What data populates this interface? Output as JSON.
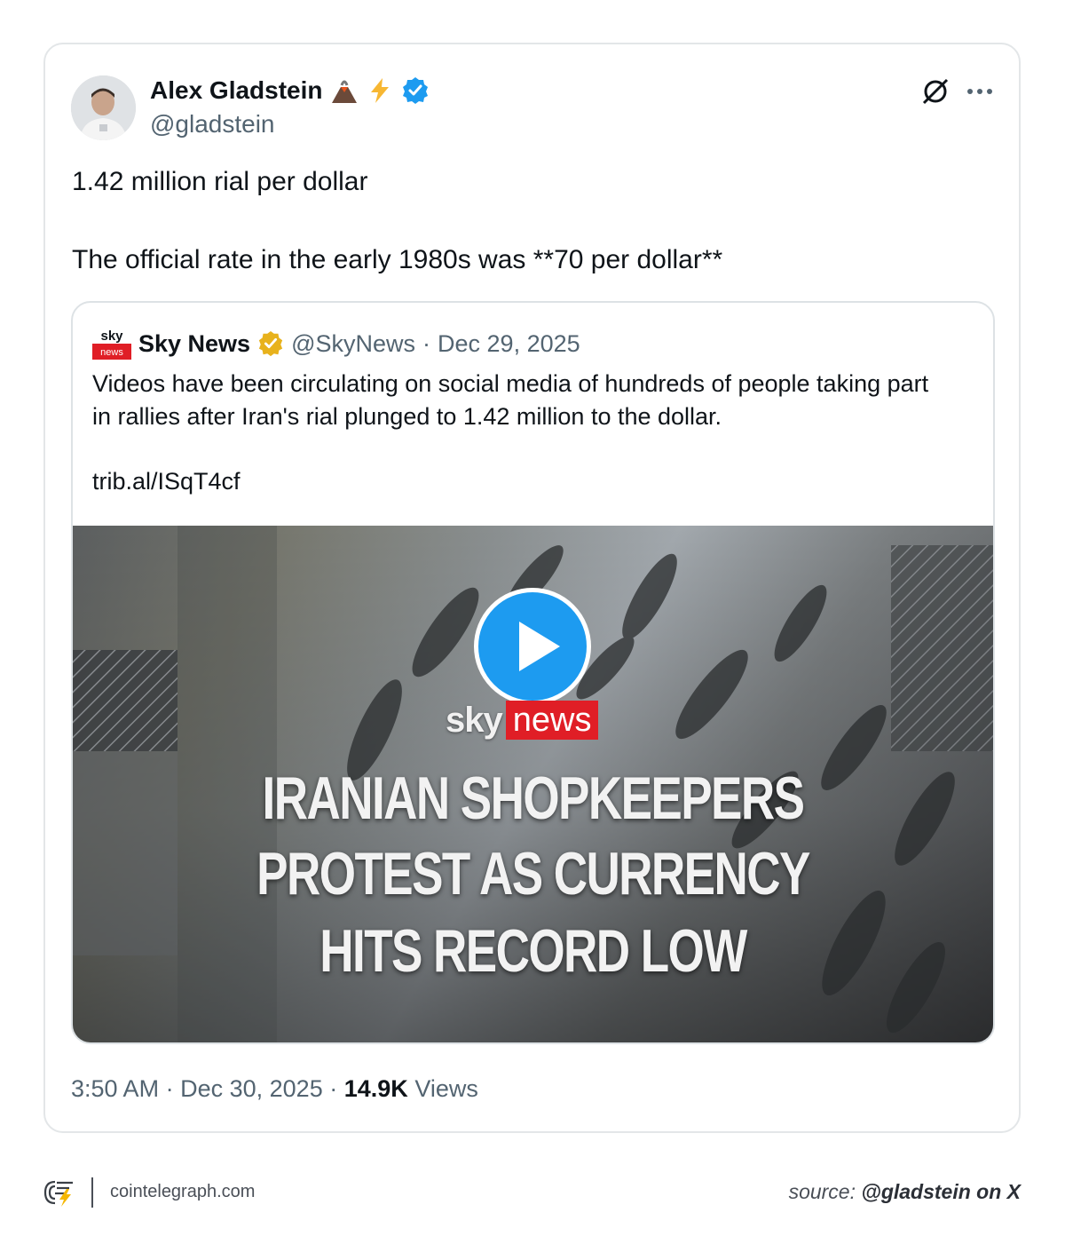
{
  "author": {
    "name": "Alex Gladstein",
    "handle": "@gladstein",
    "emoji": [
      "volcano-icon",
      "lightning-icon",
      "verified-badge-icon"
    ]
  },
  "tweet": {
    "line1": "1.42 million rial per dollar",
    "line2": "The official rate in the early 1980s was **70 per dollar**"
  },
  "quote": {
    "logo": {
      "top": "sky",
      "bottom": "news"
    },
    "name": "Sky News",
    "handle": "@SkyNews",
    "separator": "·",
    "date": "Dec 29, 2025",
    "text_line1": "Videos have been circulating on social media of hundreds of people taking part",
    "text_line2": "in rallies after Iran's rial plunged to 1.42 million to the dollar.",
    "link": "trib.al/ISqT4cf",
    "video": {
      "brand_sky": "sky",
      "brand_news": "news",
      "headline": [
        "IRANIAN SHOPKEEPERS",
        "PROTEST AS CURRENCY",
        "HITS RECORD LOW"
      ]
    }
  },
  "meta": {
    "time": "3:50 AM",
    "separator": "·",
    "date": "Dec 30, 2025",
    "views_count": "14.9K",
    "views_label": "Views"
  },
  "footer": {
    "site": "cointelegraph.com",
    "source_prefix": "source:",
    "source_handle": "@gladstein on X"
  },
  "colors": {
    "verified_blue": "#1d9bf0",
    "verified_gold": "#e8b21c",
    "sky_red": "#e01e26"
  }
}
